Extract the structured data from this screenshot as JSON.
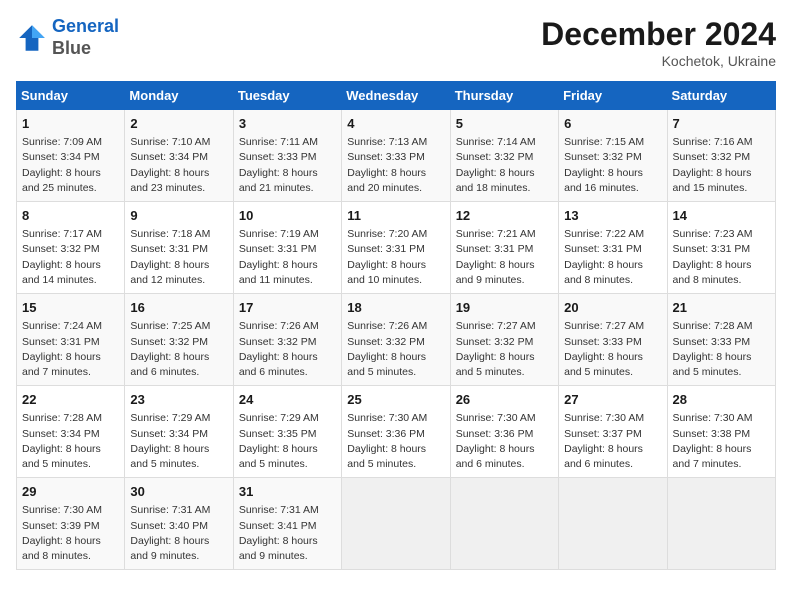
{
  "logo": {
    "line1": "General",
    "line2": "Blue"
  },
  "title": "December 2024",
  "location": "Kochetok, Ukraine",
  "days_header": [
    "Sunday",
    "Monday",
    "Tuesday",
    "Wednesday",
    "Thursday",
    "Friday",
    "Saturday"
  ],
  "weeks": [
    [
      {
        "day": "1",
        "sunrise": "7:09 AM",
        "sunset": "3:34 PM",
        "daylight": "8 hours and 25 minutes."
      },
      {
        "day": "2",
        "sunrise": "7:10 AM",
        "sunset": "3:34 PM",
        "daylight": "8 hours and 23 minutes."
      },
      {
        "day": "3",
        "sunrise": "7:11 AM",
        "sunset": "3:33 PM",
        "daylight": "8 hours and 21 minutes."
      },
      {
        "day": "4",
        "sunrise": "7:13 AM",
        "sunset": "3:33 PM",
        "daylight": "8 hours and 20 minutes."
      },
      {
        "day": "5",
        "sunrise": "7:14 AM",
        "sunset": "3:32 PM",
        "daylight": "8 hours and 18 minutes."
      },
      {
        "day": "6",
        "sunrise": "7:15 AM",
        "sunset": "3:32 PM",
        "daylight": "8 hours and 16 minutes."
      },
      {
        "day": "7",
        "sunrise": "7:16 AM",
        "sunset": "3:32 PM",
        "daylight": "8 hours and 15 minutes."
      }
    ],
    [
      {
        "day": "8",
        "sunrise": "7:17 AM",
        "sunset": "3:32 PM",
        "daylight": "8 hours and 14 minutes."
      },
      {
        "day": "9",
        "sunrise": "7:18 AM",
        "sunset": "3:31 PM",
        "daylight": "8 hours and 12 minutes."
      },
      {
        "day": "10",
        "sunrise": "7:19 AM",
        "sunset": "3:31 PM",
        "daylight": "8 hours and 11 minutes."
      },
      {
        "day": "11",
        "sunrise": "7:20 AM",
        "sunset": "3:31 PM",
        "daylight": "8 hours and 10 minutes."
      },
      {
        "day": "12",
        "sunrise": "7:21 AM",
        "sunset": "3:31 PM",
        "daylight": "8 hours and 9 minutes."
      },
      {
        "day": "13",
        "sunrise": "7:22 AM",
        "sunset": "3:31 PM",
        "daylight": "8 hours and 8 minutes."
      },
      {
        "day": "14",
        "sunrise": "7:23 AM",
        "sunset": "3:31 PM",
        "daylight": "8 hours and 8 minutes."
      }
    ],
    [
      {
        "day": "15",
        "sunrise": "7:24 AM",
        "sunset": "3:31 PM",
        "daylight": "8 hours and 7 minutes."
      },
      {
        "day": "16",
        "sunrise": "7:25 AM",
        "sunset": "3:32 PM",
        "daylight": "8 hours and 6 minutes."
      },
      {
        "day": "17",
        "sunrise": "7:26 AM",
        "sunset": "3:32 PM",
        "daylight": "8 hours and 6 minutes."
      },
      {
        "day": "18",
        "sunrise": "7:26 AM",
        "sunset": "3:32 PM",
        "daylight": "8 hours and 5 minutes."
      },
      {
        "day": "19",
        "sunrise": "7:27 AM",
        "sunset": "3:32 PM",
        "daylight": "8 hours and 5 minutes."
      },
      {
        "day": "20",
        "sunrise": "7:27 AM",
        "sunset": "3:33 PM",
        "daylight": "8 hours and 5 minutes."
      },
      {
        "day": "21",
        "sunrise": "7:28 AM",
        "sunset": "3:33 PM",
        "daylight": "8 hours and 5 minutes."
      }
    ],
    [
      {
        "day": "22",
        "sunrise": "7:28 AM",
        "sunset": "3:34 PM",
        "daylight": "8 hours and 5 minutes."
      },
      {
        "day": "23",
        "sunrise": "7:29 AM",
        "sunset": "3:34 PM",
        "daylight": "8 hours and 5 minutes."
      },
      {
        "day": "24",
        "sunrise": "7:29 AM",
        "sunset": "3:35 PM",
        "daylight": "8 hours and 5 minutes."
      },
      {
        "day": "25",
        "sunrise": "7:30 AM",
        "sunset": "3:36 PM",
        "daylight": "8 hours and 5 minutes."
      },
      {
        "day": "26",
        "sunrise": "7:30 AM",
        "sunset": "3:36 PM",
        "daylight": "8 hours and 6 minutes."
      },
      {
        "day": "27",
        "sunrise": "7:30 AM",
        "sunset": "3:37 PM",
        "daylight": "8 hours and 6 minutes."
      },
      {
        "day": "28",
        "sunrise": "7:30 AM",
        "sunset": "3:38 PM",
        "daylight": "8 hours and 7 minutes."
      }
    ],
    [
      {
        "day": "29",
        "sunrise": "7:30 AM",
        "sunset": "3:39 PM",
        "daylight": "8 hours and 8 minutes."
      },
      {
        "day": "30",
        "sunrise": "7:31 AM",
        "sunset": "3:40 PM",
        "daylight": "8 hours and 9 minutes."
      },
      {
        "day": "31",
        "sunrise": "7:31 AM",
        "sunset": "3:41 PM",
        "daylight": "8 hours and 9 minutes."
      },
      null,
      null,
      null,
      null
    ]
  ],
  "labels": {
    "sunrise": "Sunrise:",
    "sunset": "Sunset:",
    "daylight": "Daylight:"
  }
}
